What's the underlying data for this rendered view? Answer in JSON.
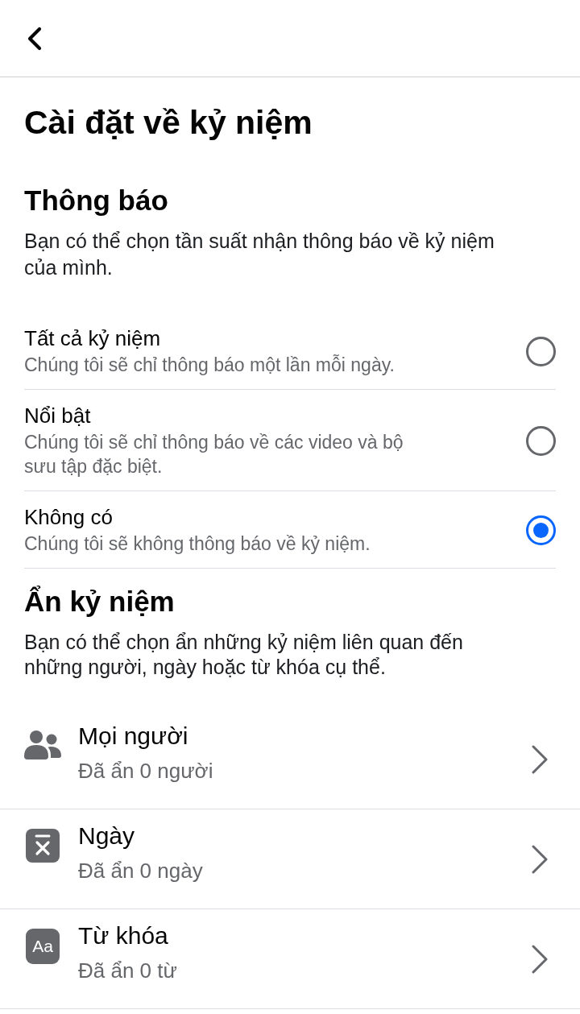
{
  "title": "Cài đặt về kỷ niệm",
  "notifications": {
    "heading": "Thông báo",
    "description": "Bạn có thể chọn tần suất nhận thông báo về kỷ niệm của mình.",
    "options": [
      {
        "label": "Tất cả kỷ niệm",
        "description": "Chúng tôi sẽ chỉ thông báo một lần mỗi ngày.",
        "selected": false
      },
      {
        "label": "Nổi bật",
        "description": "Chúng tôi sẽ chỉ thông báo về các video và bộ sưu tập đặc biệt.",
        "selected": false
      },
      {
        "label": "Không có",
        "description": "Chúng tôi sẽ không thông báo về kỷ niệm.",
        "selected": true
      }
    ]
  },
  "hide_memories": {
    "heading": "Ẩn kỷ niệm",
    "description": "Bạn có thể chọn ẩn những kỷ niệm liên quan đến những người, ngày hoặc từ khóa cụ thể.",
    "items": [
      {
        "kind": "people",
        "label": "Mọi người",
        "detail": "Đã ẩn 0 người"
      },
      {
        "kind": "date",
        "label": "Ngày",
        "detail": "Đã ẩn 0 ngày"
      },
      {
        "kind": "keyword",
        "icon_text": "Aa",
        "label": "Từ khóa",
        "detail": "Đã ẩn 0 từ"
      }
    ]
  }
}
